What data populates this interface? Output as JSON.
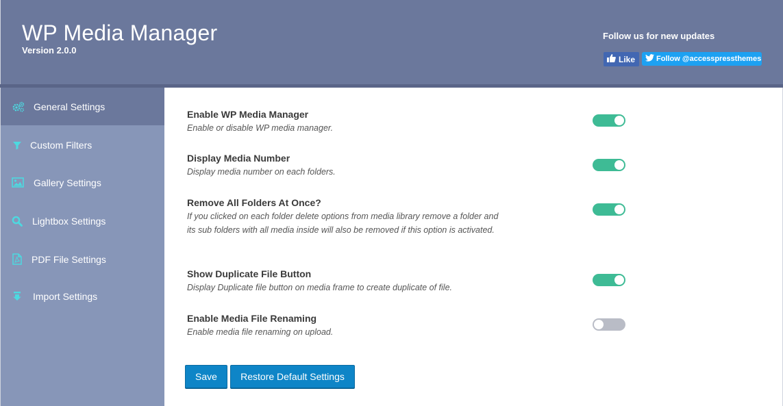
{
  "header": {
    "title": "WP Media Manager",
    "version": "Version 2.0.0",
    "follow_text": "Follow us for new updates",
    "like_label": "Like",
    "twitter_label": "Follow @accesspressthemes"
  },
  "sidebar": {
    "items": [
      {
        "label": "General Settings",
        "icon": "gears-icon",
        "active": true
      },
      {
        "label": "Custom Filters",
        "icon": "filter-icon",
        "active": false
      },
      {
        "label": "Gallery Settings",
        "icon": "image-icon",
        "active": false
      },
      {
        "label": "Lightbox Settings",
        "icon": "search-icon",
        "active": false
      },
      {
        "label": "PDF File Settings",
        "icon": "pdf-file-icon",
        "active": false
      },
      {
        "label": "Import Settings",
        "icon": "import-icon",
        "active": false
      }
    ]
  },
  "settings": [
    {
      "title": "Enable WP Media Manager",
      "description": "Enable or disable WP media manager.",
      "enabled": true
    },
    {
      "title": "Display Media Number",
      "description": "Display media number on each folders.",
      "enabled": true
    },
    {
      "title": "Remove All Folders At Once?",
      "description": "If you clicked on each folder delete options from media library remove a folder and its sub folders with all media inside will also be removed if this option is activated.",
      "enabled": true
    },
    {
      "title": "Show Duplicate File Button",
      "description": "Display Duplicate file button on media frame to create duplicate of file.",
      "enabled": true
    },
    {
      "title": "Enable Media File Renaming",
      "description": "Enable media file renaming on upload.",
      "enabled": false
    }
  ],
  "buttons": {
    "save_label": "Save",
    "restore_label": "Restore Default Settings"
  },
  "colors": {
    "header_bg": "#6b789c",
    "sidebar_bg": "#8796b8",
    "toggle_on": "#3ebb95",
    "toggle_off": "#b9bcc6",
    "button_bg": "#0e85c7",
    "icon_accent": "#4dd9e0"
  }
}
